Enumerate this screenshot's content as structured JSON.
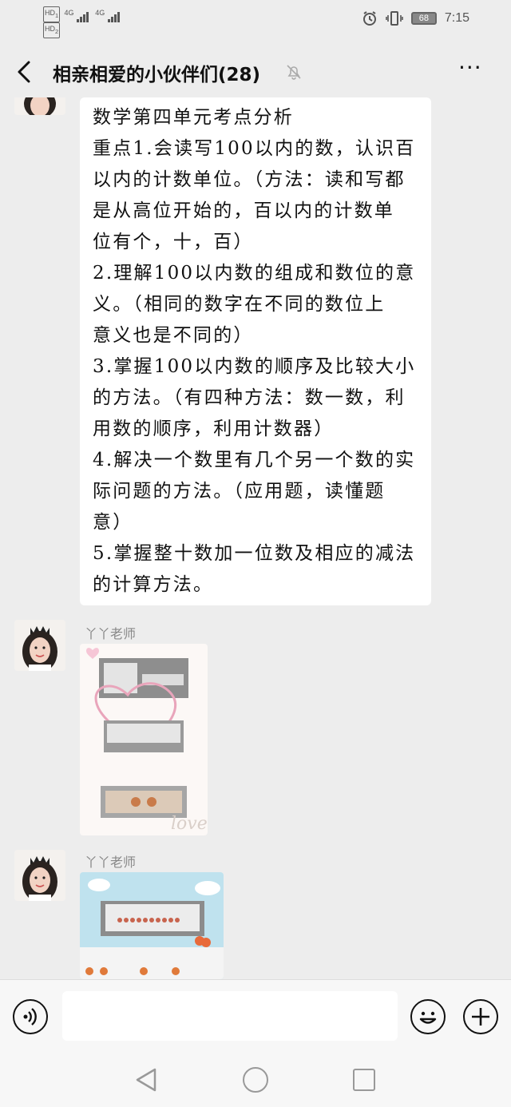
{
  "status_bar": {
    "sim1_label": "HD",
    "sim1_index": "1",
    "sim1_net": "4G",
    "sim2_label": "HD",
    "sim2_index": "2",
    "sim2_net": "4G",
    "battery": "68",
    "time": "7:15",
    "icons": [
      "alarm-icon",
      "vibrate-icon",
      "battery-icon"
    ]
  },
  "header": {
    "title": "相亲相爱的小伙伴们(28)",
    "back_icon": "chevron-left-icon",
    "mute_icon": "bell-off-icon",
    "more_icon": "more-dots-icon",
    "more_label": "···"
  },
  "messages": {
    "text_message": {
      "lines": [
        "数学第四单元考点分析",
        "重点1.会读写100以内的数，认识百",
        "以内的计数单位。（方法：读和写都",
        "是从高位开始的，百以内的计数单",
        "位有个，十，百）",
        "2.理解100以内数的组成和数位的意",
        "义。（相同的数字在不同的数位上",
        "意义也是不同的）",
        "3.掌握100以内数的顺序及比较大小",
        "的方法。（有四种方法：数一数，利",
        "用数的顺序，利用计数器）",
        "4.解决一个数里有几个另一个数的实",
        "际问题的方法。（应用题，读懂题",
        "意）",
        "5.掌握整十数加一位数及相应的减法",
        "的计算方法。"
      ]
    },
    "image_message_1": {
      "sender": "丫丫老师",
      "decoration_text": "love"
    },
    "image_message_2": {
      "sender": "丫丫老师"
    }
  },
  "input_bar": {
    "voice_icon": "voice-icon",
    "emoji_icon": "emoji-icon",
    "plus_icon": "plus-icon",
    "placeholder": ""
  },
  "nav_bar": {
    "icons": [
      "nav-back-icon",
      "nav-home-icon",
      "nav-recent-icon"
    ]
  },
  "colors": {
    "background": "#ededed",
    "bubble": "#ffffff",
    "sender_name": "#888888"
  }
}
